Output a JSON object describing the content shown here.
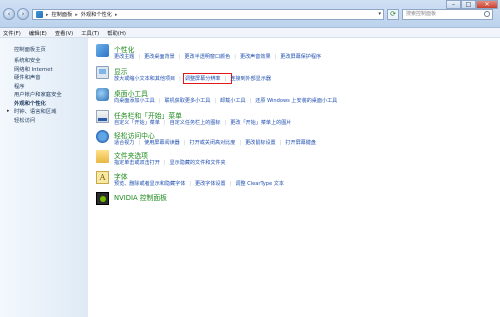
{
  "address": {
    "crumbs": [
      "控制面板",
      "外观和个性化"
    ],
    "search_placeholder": "搜索控制面板"
  },
  "window_controls": {
    "minimize": "–",
    "maximize": "□",
    "close": "✕"
  },
  "menubar": {
    "items": [
      "文件(F)",
      "编辑(E)",
      "查看(V)",
      "工具(T)",
      "帮助(H)"
    ]
  },
  "sidebar": {
    "home": "控制面板主页",
    "items": [
      {
        "label": "系统和安全",
        "active": false
      },
      {
        "label": "网络和 Internet",
        "active": false
      },
      {
        "label": "硬件和声音",
        "active": false
      },
      {
        "label": "程序",
        "active": false
      },
      {
        "label": "用户帐户和家庭安全",
        "active": false
      },
      {
        "label": "外观和个性化",
        "active": true
      },
      {
        "label": "时钟、语言和区域",
        "active": false
      },
      {
        "label": "轻松访问",
        "active": false
      }
    ]
  },
  "categories": [
    {
      "heading": "个性化",
      "icon": "personalization-icon",
      "links": [
        "更改主题",
        "更改桌面背景",
        "更改半透明窗口颜色",
        "更改声音效果",
        "更改屏幕保护程序"
      ]
    },
    {
      "heading": "显示",
      "icon": "display-icon",
      "links": [
        "放大或缩小文本和其他项目",
        "调整屏幕分辨率",
        "连接到外部显示器"
      ]
    },
    {
      "heading": "桌面小工具",
      "icon": "gadgets-icon",
      "links": [
        "向桌面添加小工具",
        "联机获取更多小工具",
        "卸载小工具",
        "还原 Windows 上安装的桌面小工具"
      ]
    },
    {
      "heading": "任务栏和「开始」菜单",
      "icon": "taskbar-icon",
      "links": [
        "自定义「开始」菜单",
        "自定义任务栏上的图标",
        "更改「开始」菜单上的图片"
      ]
    },
    {
      "heading": "轻松访问中心",
      "icon": "ease-of-access-icon",
      "links": [
        "适合视力",
        "使用屏幕阅读器",
        "打开或关闭高对比度",
        "更改鼠标设置",
        "打开屏幕键盘"
      ]
    },
    {
      "heading": "文件夹选项",
      "icon": "folder-options-icon",
      "links": [
        "指定单击或双击打开",
        "显示隐藏的文件和文件夹"
      ]
    },
    {
      "heading": "字体",
      "icon": "fonts-icon",
      "links": [
        "预览、删除或者显示和隐藏字体",
        "更改字体设置",
        "调整 ClearType 文本"
      ]
    },
    {
      "heading": "NVIDIA 控制面板",
      "icon": "nvidia-icon",
      "links": []
    }
  ],
  "highlighted_link": "调整屏幕分辨率"
}
